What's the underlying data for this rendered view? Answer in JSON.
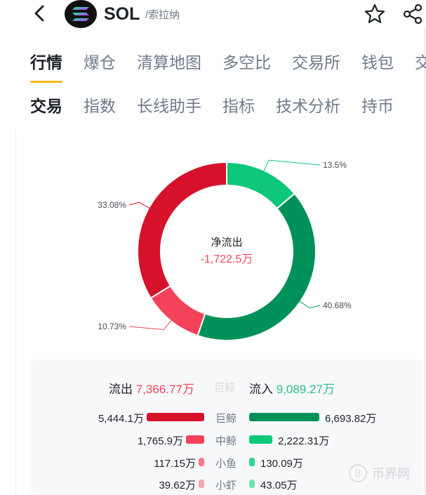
{
  "header": {
    "symbol": "SOL",
    "subtitle": "/索拉纳"
  },
  "tabs_primary": [
    "行情",
    "爆仓",
    "清算地图",
    "多空比",
    "交易所",
    "钱包",
    "交"
  ],
  "tabs_secondary": [
    "交易",
    "指数",
    "长线助手",
    "指标",
    "技术分析",
    "持币"
  ],
  "chart_data": {
    "type": "pie",
    "center_label": "净流出",
    "center_value": "-1,722.5万",
    "slices": [
      {
        "label": "13.5%",
        "value": 13.5,
        "color": "#0ec77a"
      },
      {
        "label": "40.68%",
        "value": 40.68,
        "color": "#00915a"
      },
      {
        "label": "10.73%",
        "value": 10.73,
        "color": "#f3425a"
      },
      {
        "label": "33.08%",
        "value": 33.08,
        "color": "#d5122a"
      }
    ]
  },
  "summary": {
    "outflow_label": "流出",
    "outflow_value": "7,366.77万",
    "middle_ghost": "巨鲸",
    "inflow_label": "流入",
    "inflow_value": "9,089.27万"
  },
  "rows": [
    {
      "cat": "巨鲸",
      "out": "5,444.1万",
      "in": "6,693.82万",
      "out_frac": 1.0,
      "in_frac": 1.0,
      "out_color": "#d5122a",
      "in_color": "#00915a"
    },
    {
      "cat": "中鲸",
      "out": "1,765.9万",
      "in": "2,222.31万",
      "out_frac": 0.32,
      "in_frac": 0.33,
      "out_color": "#f3425a",
      "in_color": "#0ec77a"
    },
    {
      "cat": "小鱼",
      "out": "117.15万",
      "in": "130.09万",
      "out_frac": 0.02,
      "in_frac": 0.02,
      "out_color": "#f77a88",
      "in_color": "#33d48f"
    },
    {
      "cat": "小虾",
      "out": "39.62万",
      "in": "43.05万",
      "out_frac": 0.007,
      "in_frac": 0.006,
      "out_color": "#f9a6b0",
      "in_color": "#6ee5b0"
    }
  ],
  "watermark": "币界网"
}
